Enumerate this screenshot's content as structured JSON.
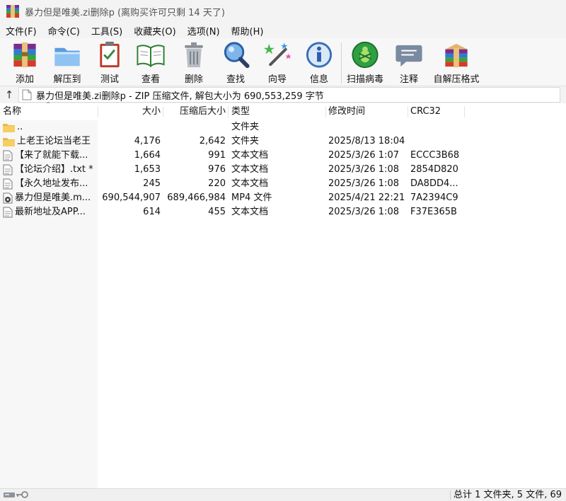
{
  "window": {
    "title": "暴力但是唯美.zi删除p (离购买许可只剩 14 天了)",
    "icon": "winrar-books-icon"
  },
  "menu": [
    {
      "label": "文件(F)"
    },
    {
      "label": "命令(C)"
    },
    {
      "label": "工具(S)"
    },
    {
      "label": "收藏夹(O)"
    },
    {
      "label": "选项(N)"
    },
    {
      "label": "帮助(H)"
    }
  ],
  "toolbar": [
    {
      "label": "添加",
      "icon": "add-archive-icon"
    },
    {
      "label": "解压到",
      "icon": "extract-folder-icon"
    },
    {
      "label": "测试",
      "icon": "test-clipboard-icon"
    },
    {
      "label": "查看",
      "icon": "view-book-icon"
    },
    {
      "label": "删除",
      "icon": "trash-icon"
    },
    {
      "label": "查找",
      "icon": "magnifier-icon"
    },
    {
      "label": "向导",
      "icon": "wizard-wand-icon"
    },
    {
      "label": "信息",
      "icon": "info-icon"
    },
    {
      "label": "扫描病毒",
      "icon": "virus-scan-icon"
    },
    {
      "label": "注释",
      "icon": "comment-icon"
    },
    {
      "label": "自解压格式",
      "icon": "sfx-archive-icon"
    }
  ],
  "address": {
    "path": "暴力但是唯美.zi删除p - ZIP 压缩文件, 解包大小为 690,553,259 字节"
  },
  "columns": {
    "name": "名称",
    "size": "大小",
    "packed": "压缩后大小",
    "type": "类型",
    "modified": "修改时间",
    "crc": "CRC32"
  },
  "rows": [
    {
      "icon": "folder-icon",
      "name": "..",
      "size": "",
      "packed": "",
      "type": "文件夹",
      "modified": "",
      "crc": ""
    },
    {
      "icon": "folder-icon",
      "name": "上老王论坛当老王",
      "size": "4,176",
      "packed": "2,642",
      "type": "文件夹",
      "modified": "2025/8/13 18:04",
      "crc": ""
    },
    {
      "icon": "text-file-icon",
      "name": "【来了就能下载...",
      "size": "1,664",
      "packed": "991",
      "type": "文本文档",
      "modified": "2025/3/26 1:07",
      "crc": "ECCC3B68"
    },
    {
      "icon": "text-file-icon",
      "name": "【论坛介绍】.txt *",
      "size": "1,653",
      "packed": "976",
      "type": "文本文档",
      "modified": "2025/3/26 1:08",
      "crc": "2854D820"
    },
    {
      "icon": "text-file-icon",
      "name": "【永久地址发布...",
      "size": "245",
      "packed": "220",
      "type": "文本文档",
      "modified": "2025/3/26 1:08",
      "crc": "DA8DD4..."
    },
    {
      "icon": "video-file-icon",
      "name": "暴力但是唯美.m...",
      "size": "690,544,907",
      "packed": "689,466,984",
      "type": "MP4 文件",
      "modified": "2025/4/21 22:21",
      "crc": "7A2394C9"
    },
    {
      "icon": "text-file-icon",
      "name": "最新地址及APP...",
      "size": "614",
      "packed": "455",
      "type": "文本文档",
      "modified": "2025/3/26 1:08",
      "crc": "F37E365B"
    }
  ],
  "status": {
    "summary": "总计 1 文件夹, 5 文件, 69"
  }
}
